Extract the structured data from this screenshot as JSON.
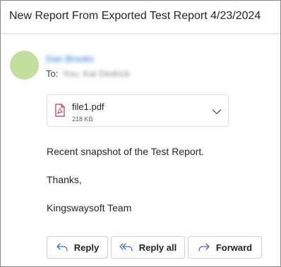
{
  "message": {
    "subject": "New Report From Exported Test Report 4/23/2024",
    "sender_name": "Dan Brooks",
    "to_label": "To:",
    "recipients": "You; Kai Dedrick"
  },
  "attachment": {
    "file_name": "file1.pdf",
    "file_size": "218 KB",
    "icon": "pdf-file-icon",
    "expand_icon": "chevron-down-icon"
  },
  "body": {
    "line1": "Recent snapshot of the Test Report.",
    "line2": "Thanks,",
    "line3": "Kingswaysoft Team"
  },
  "actions": {
    "reply_label": "Reply",
    "reply_all_label": "Reply all",
    "forward_label": "Forward"
  },
  "colors": {
    "avatar": "#c2df9d",
    "sender_link": "#1f6fd1",
    "pdf_red": "#c4314b"
  }
}
